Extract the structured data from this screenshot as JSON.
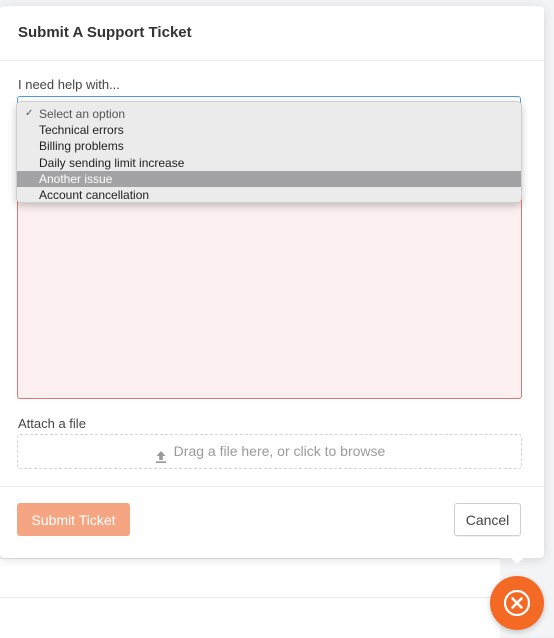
{
  "modal": {
    "title": "Submit A Support Ticket"
  },
  "help_select": {
    "label": "I need help with...",
    "options": [
      {
        "label": "Select an option",
        "selected": true,
        "highlighted": false
      },
      {
        "label": "Technical errors",
        "selected": false,
        "highlighted": false
      },
      {
        "label": "Billing problems",
        "selected": false,
        "highlighted": false
      },
      {
        "label": "Daily sending limit increase",
        "selected": false,
        "highlighted": false
      },
      {
        "label": "Another issue",
        "selected": false,
        "highlighted": true
      },
      {
        "label": "Account cancellation",
        "selected": false,
        "highlighted": false
      }
    ]
  },
  "attachment": {
    "label": "Attach a file",
    "dropzone_text": "Drag a file here, or click to browse",
    "icon": "upload-icon"
  },
  "footer": {
    "submit_label": "Submit Ticket",
    "cancel_label": "Cancel"
  },
  "close_button": {
    "icon": "close-icon"
  },
  "colors": {
    "accent": "#f46a25",
    "submit_bg": "#f6a582",
    "select_focus": "#4a9be8",
    "error_border": "#e07676",
    "error_bg": "#fbefef",
    "highlight": "#a3a3a6"
  }
}
